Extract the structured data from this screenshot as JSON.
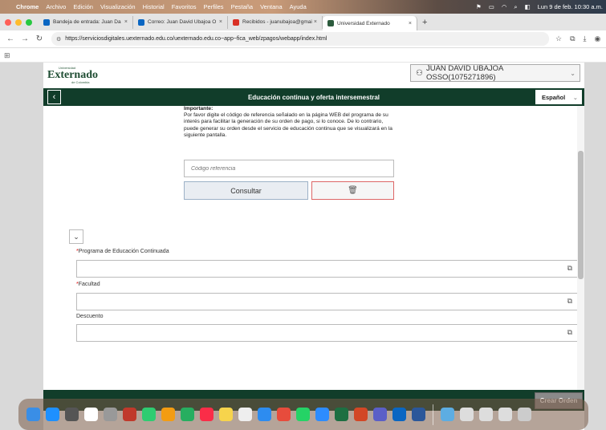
{
  "menubar": {
    "apple": "",
    "app_name": "Chrome",
    "items": [
      "Archivo",
      "Edición",
      "Visualización",
      "Historial",
      "Favoritos",
      "Perfiles",
      "Pestaña",
      "Ventana",
      "Ayuda"
    ],
    "clock": "Lun 9 de feb.  10:30 a.m."
  },
  "tabs": [
    {
      "label": "Bandeja de entrada: Juan Da",
      "color": "#0a66c2"
    },
    {
      "label": "Correo: Juan David Ubajoa O",
      "color": "#0a66c2"
    },
    {
      "label": "Recibidos - juanubajoa@gmai",
      "color": "#d93025"
    },
    {
      "label": "Universidad Externado",
      "color": "#2c5b3d"
    }
  ],
  "tab_close": "×",
  "new_tab": "+",
  "address": {
    "url": "https://serviciosdigitales.uexternado.edu.co/uexternado.edu.co~app~fica_web/zpagos/webapp/index.html"
  },
  "bookmarks_icon": "⊞",
  "header": {
    "logo_top": "Universidad",
    "logo": "Externado",
    "logo_sub": "de Colombia",
    "user": "JUAN DAVID UBAJOA OSSO(1075271896)"
  },
  "titlebar": {
    "title": "Educación continua y oferta intersemestral",
    "back": "‹",
    "language": "Español"
  },
  "instructions": {
    "heading": "Importante:",
    "body": "Por favor digite el código de referencia señalado en la página WEB del programa de su interés para facilitar la generación de su orden de pago, si lo conoce. De lo contrario, puede generar su orden desde el servicio de educación continua que se visualizará en la siguiente pantalla."
  },
  "code_input": {
    "placeholder": "Código referencia",
    "value": ""
  },
  "buttons": {
    "consult": "Consultar",
    "create": "Crear Orden"
  },
  "fields": [
    {
      "label": "Programa de Educación Continuada",
      "required": true,
      "value": ""
    },
    {
      "label": "Facultad",
      "required": true,
      "value": ""
    },
    {
      "label": "Descuento",
      "required": false,
      "value": ""
    }
  ],
  "required_mark": "*",
  "colors": {
    "primary_green": "#113d2a",
    "required_red": "#dd0000"
  }
}
